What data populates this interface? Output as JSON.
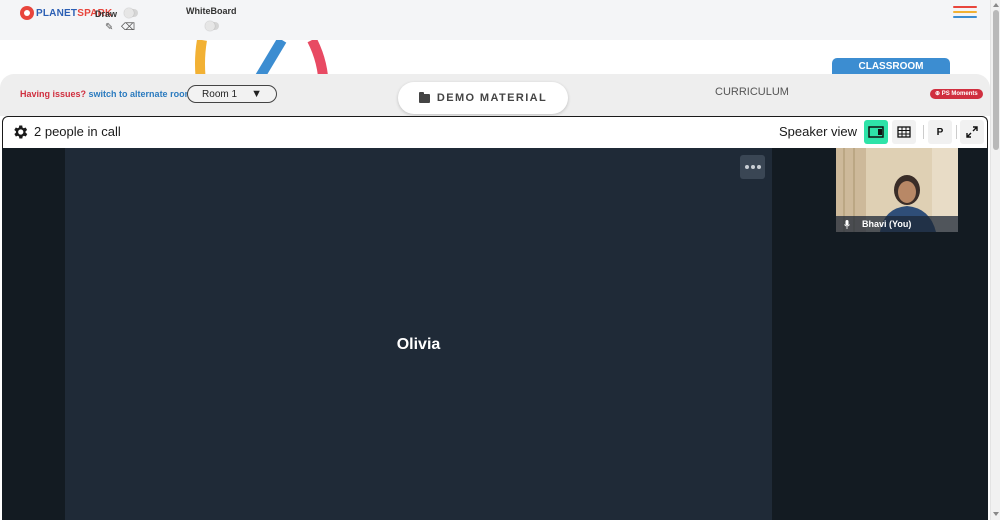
{
  "logo": {
    "part1": "PLANET",
    "part2": "SPARK"
  },
  "toolbar": {
    "draw_label": "Draw",
    "whiteboard_label": "WhiteBoard"
  },
  "issue": {
    "question": "Having issues?",
    "link": "switch to alternate room"
  },
  "room": {
    "selected": "Room 1"
  },
  "tabs": {
    "demo_material": "DEMO MATERIAL",
    "curriculum": "CURRICULUM",
    "classroom": "CLASSROOM",
    "ps_moments": "PS Moments"
  },
  "call": {
    "people_count_text": "2 people in call",
    "view_label": "Speaker view",
    "p_label": "P"
  },
  "participants": {
    "main": "Olivia",
    "self": "Bhavi (You)"
  },
  "colors": {
    "accent_green": "#2ee3a8",
    "classroom_blue": "#3c8dd1",
    "brand_red": "#d02f3f",
    "stage_dark": "#131b22",
    "tile_bg": "#1f2a37"
  }
}
